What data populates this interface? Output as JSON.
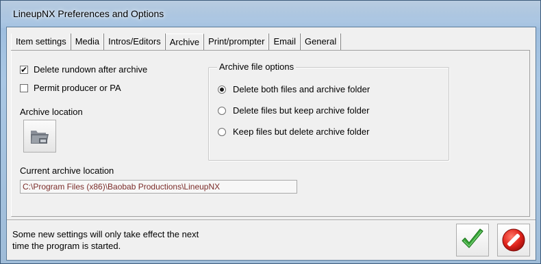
{
  "window": {
    "title": "LineupNX Preferences and Options"
  },
  "tabs": [
    {
      "label": "Item settings"
    },
    {
      "label": "Media"
    },
    {
      "label": "Intros/Editors"
    },
    {
      "label": "Archive",
      "active": true
    },
    {
      "label": "Print/prompter"
    },
    {
      "label": "Email"
    },
    {
      "label": "General"
    }
  ],
  "archive": {
    "delete_rundown": {
      "label": "Delete rundown after archive",
      "checked": true,
      "mark": "✔"
    },
    "permit_producer": {
      "label": "Permit producer or PA",
      "checked": false
    },
    "location_label": "Archive location",
    "location_button_icon": "folder-icon",
    "current_location_label": "Current archive location",
    "current_location_value": "C:\\Program Files (x86)\\Baobab Productions\\LineupNX",
    "file_options": {
      "title": "Archive file options",
      "options": [
        {
          "label": "Delete both files and archive folder",
          "selected": true
        },
        {
          "label": "Delete files but keep archive folder",
          "selected": false
        },
        {
          "label": "Keep files but delete archive folder",
          "selected": false
        }
      ]
    }
  },
  "footer": {
    "note_line1": "Some new settings will only take effect the next",
    "note_line2": "time the program is started.",
    "ok_icon": "checkmark-icon",
    "cancel_icon": "no-entry-icon",
    "colors": {
      "ok": "#3aa63a",
      "cancel": "#d61e1e"
    }
  }
}
